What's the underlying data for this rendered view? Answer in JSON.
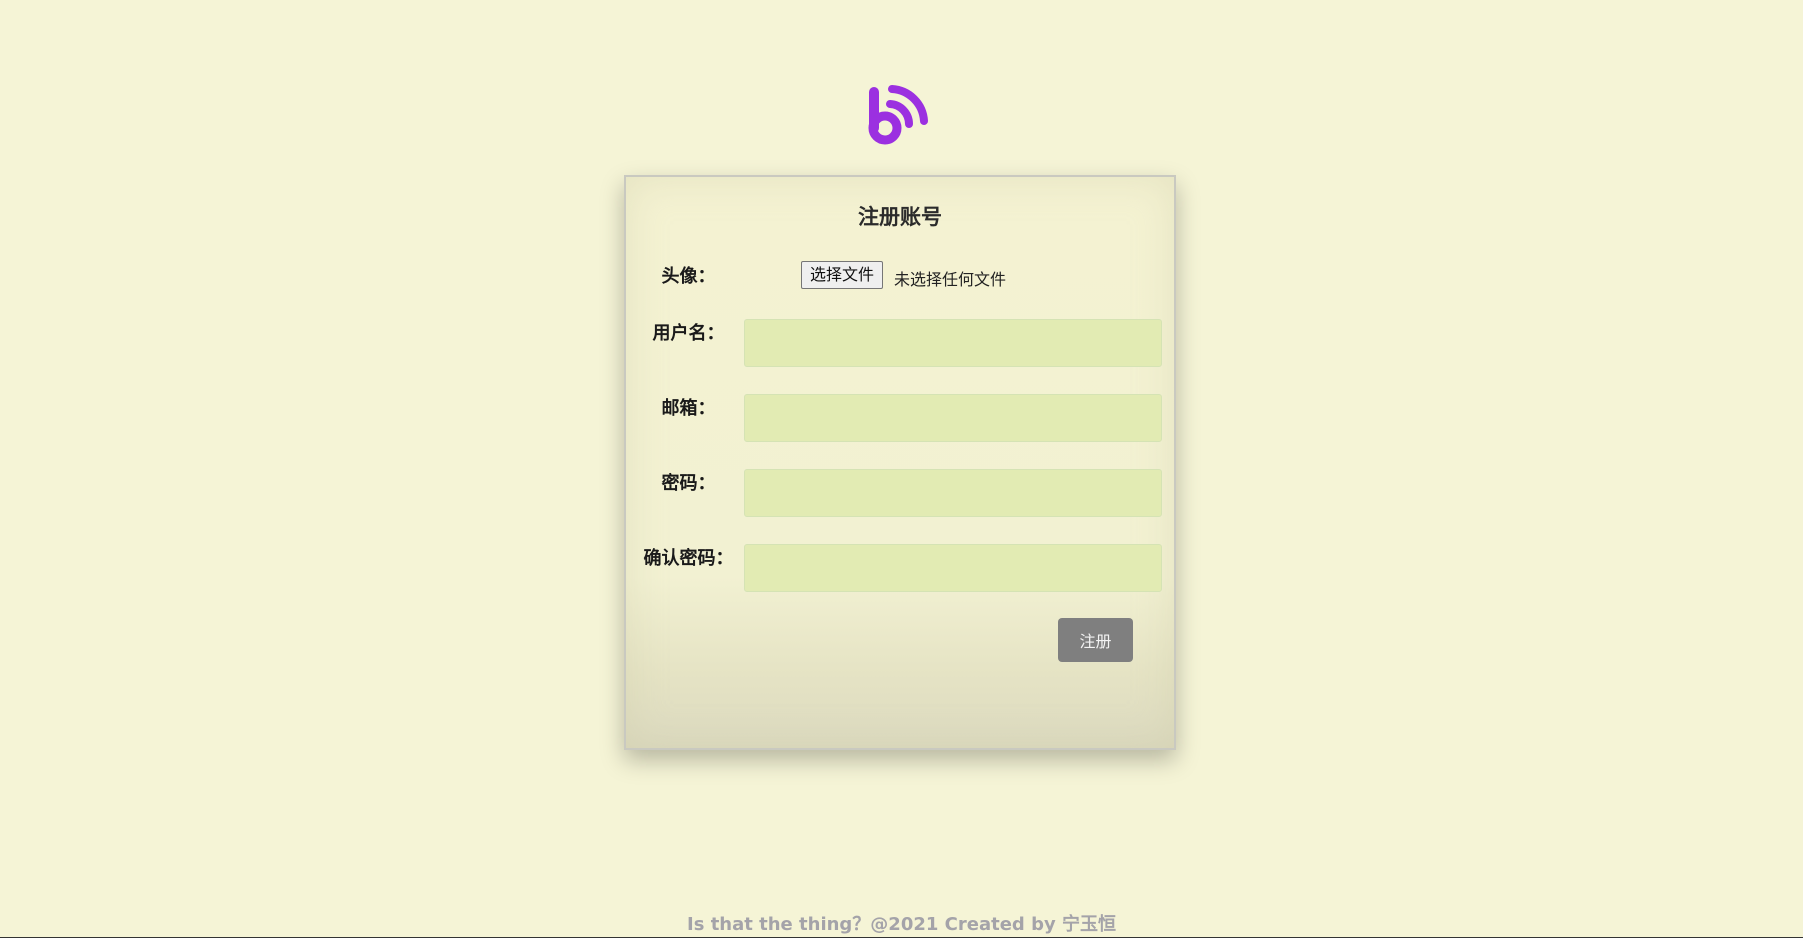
{
  "form": {
    "title": "注册账号",
    "avatar_label": "头像：",
    "file_button_label": "选择文件",
    "file_status": "未选择任何文件",
    "username_label": "用户名：",
    "email_label": "邮箱：",
    "password_label": "密码：",
    "confirm_password_label": "确认密码：",
    "submit_label": "注册"
  },
  "footer": {
    "text": "Is that the thing？@2021 Created by 宁玉恒"
  },
  "colors": {
    "background": "#f5f4d6",
    "logo": "#9b30e0",
    "input_fill": "#e2ebb3",
    "button": "#7f7f7f"
  },
  "icons": {
    "logo": "blog-feed-icon"
  }
}
